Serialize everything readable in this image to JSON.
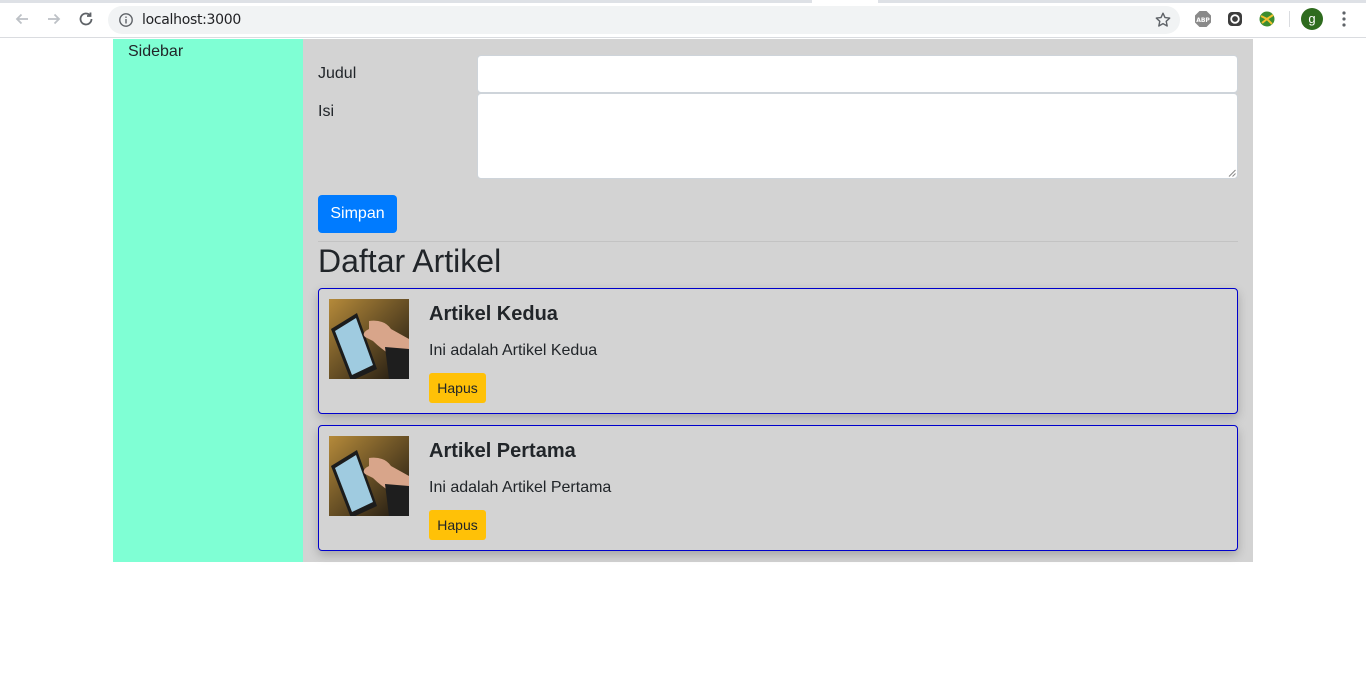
{
  "browser": {
    "url": "localhost:3000",
    "profile_initial": "g",
    "extensions": [
      "abp-icon",
      "extension-icon",
      "globe-extension-icon"
    ]
  },
  "sidebar": {
    "label": "Sidebar"
  },
  "form": {
    "title_label": "Judul",
    "title_value": "",
    "content_label": "Isi",
    "content_value": "",
    "submit_label": "Simpan"
  },
  "articles": {
    "heading": "Daftar Artikel",
    "items": [
      {
        "title": "Artikel Kedua",
        "body": "Ini adalah Artikel Kedua",
        "delete_label": "Hapus"
      },
      {
        "title": "Artikel Pertama",
        "body": "Ini adalah Artikel Pertama",
        "delete_label": "Hapus"
      }
    ]
  },
  "colors": {
    "sidebar_bg": "#7fffd4",
    "content_bg": "#d3d3d3",
    "primary": "#007bff",
    "warning": "#ffc107",
    "card_border": "#0000cc"
  }
}
